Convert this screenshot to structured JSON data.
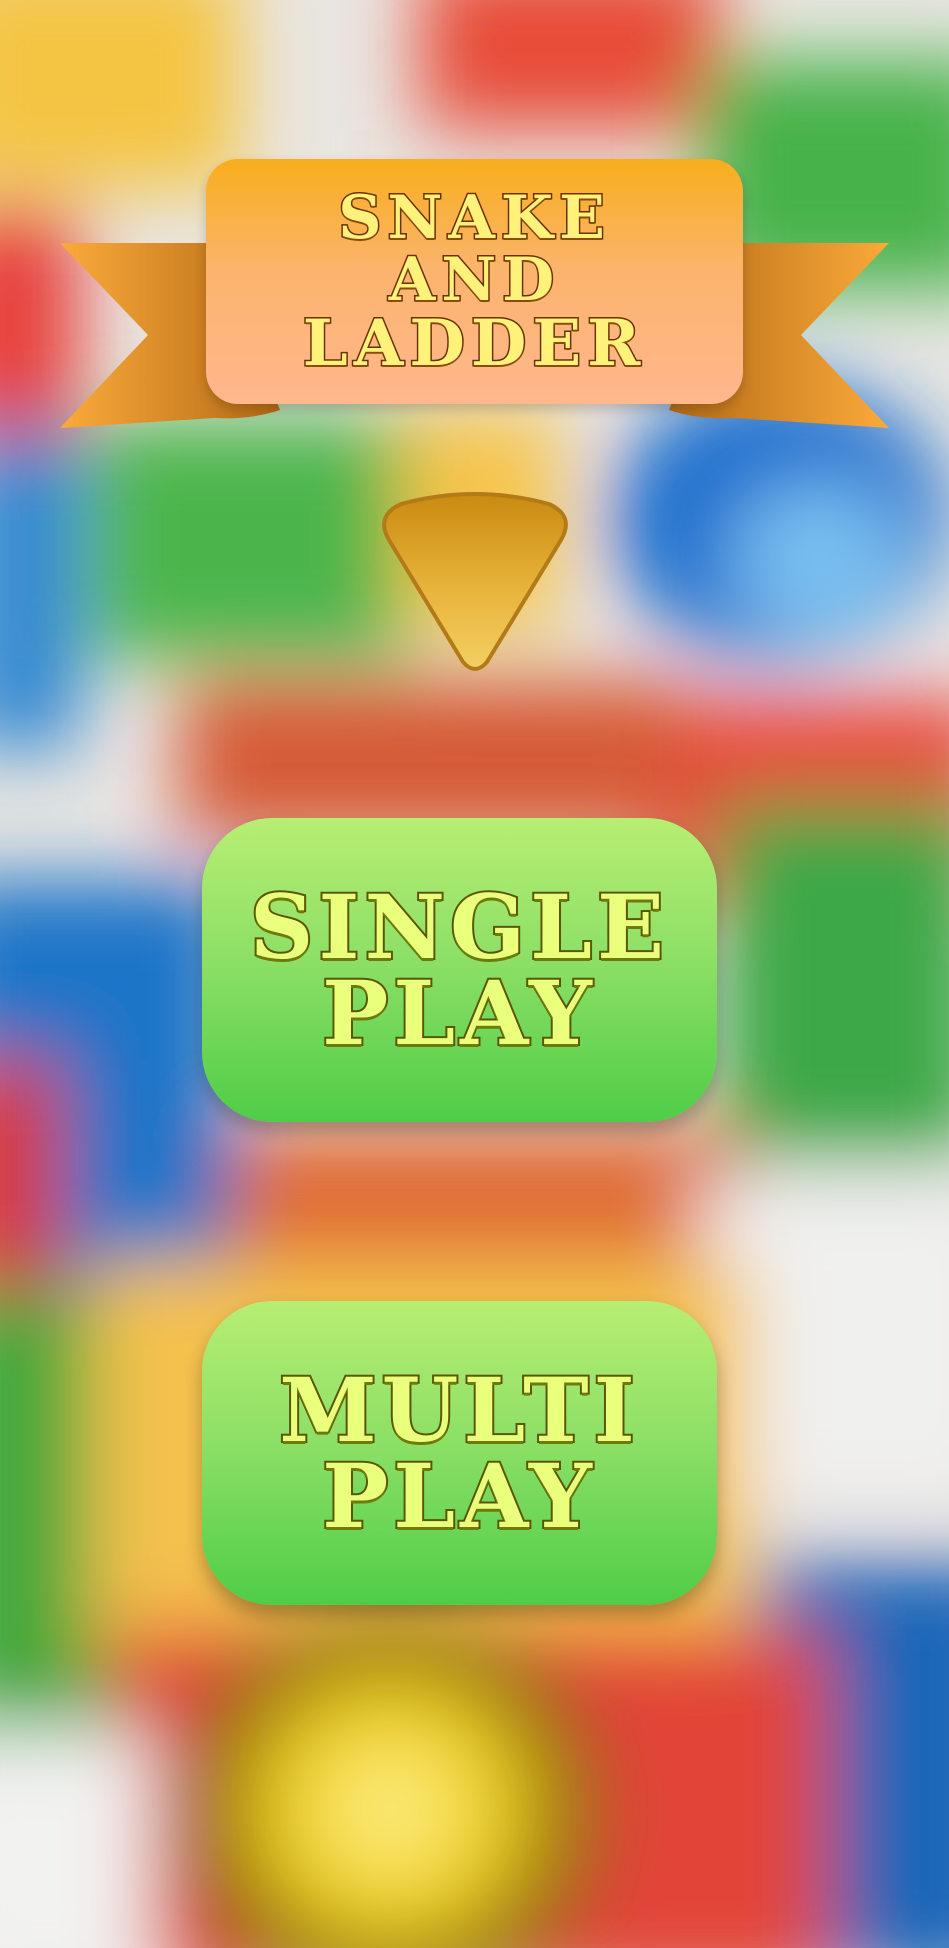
{
  "title": {
    "line1": "SNAKE",
    "line2": "AND",
    "line3": "LADDER"
  },
  "menu": {
    "single": {
      "line1": "SINGLE",
      "line2": "PLAY"
    },
    "multi": {
      "line1": "MULTI",
      "line2": "PLAY"
    }
  },
  "icons": {
    "pointer": "down-triangle-icon",
    "ribbon": "ribbon-icon"
  },
  "colors": {
    "banner_top": "#f8ae1c",
    "banner_bottom": "#ffb78d",
    "ribbon": "#e08a24",
    "button_top": "#b7ee73",
    "button_bottom": "#4fcd48",
    "title_text": "#fff27a",
    "button_text": "#eaff7c"
  }
}
